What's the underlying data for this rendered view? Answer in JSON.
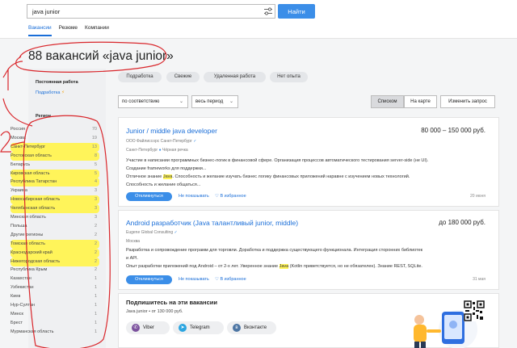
{
  "search": {
    "value": "java junior",
    "button_label": "Найти"
  },
  "tabs": [
    {
      "label": "Вакансии"
    },
    {
      "label": "Резюме"
    },
    {
      "label": "Компании"
    }
  ],
  "page_title": "88 вакансий «java junior»",
  "sidebar": {
    "employment_heading": "Постоянная работа",
    "employment_link": "Подработка",
    "region_heading": "Регион",
    "regions": [
      {
        "name": "Россия",
        "count": "70"
      },
      {
        "name": "Москва",
        "count": "19"
      },
      {
        "name": "Санкт-Петербург",
        "count": "13"
      },
      {
        "name": "Ростовская область",
        "count": "8"
      },
      {
        "name": "Беларусь",
        "count": "5"
      },
      {
        "name": "Кировская область",
        "count": "5"
      },
      {
        "name": "Республика Татарстан",
        "count": "4"
      },
      {
        "name": "Украина",
        "count": "3"
      },
      {
        "name": "Новосибирская область",
        "count": "3"
      },
      {
        "name": "Челябинская область",
        "count": "3"
      },
      {
        "name": "Минская область",
        "count": "3"
      },
      {
        "name": "Польша",
        "count": "2"
      },
      {
        "name": "Другие регионы",
        "count": "2"
      },
      {
        "name": "Томская область",
        "count": "2"
      },
      {
        "name": "Краснодарский край",
        "count": "2"
      },
      {
        "name": "Нижегородская область",
        "count": "2"
      },
      {
        "name": "Республика Крым",
        "count": "2"
      },
      {
        "name": "Казахстан",
        "count": "1"
      },
      {
        "name": "Узбекистан",
        "count": "1"
      },
      {
        "name": "Киев",
        "count": "1"
      },
      {
        "name": "Нур-Султан",
        "count": "1"
      },
      {
        "name": "Минск",
        "count": "1"
      },
      {
        "name": "Брест",
        "count": "1"
      },
      {
        "name": "Мурманская область",
        "count": "1"
      }
    ]
  },
  "chips": [
    {
      "label": "Подработка"
    },
    {
      "label": "Свежие"
    },
    {
      "label": "Удаленная работа"
    },
    {
      "label": "Нет опыта"
    }
  ],
  "sort": {
    "order": "по соответствию",
    "period": "весь период"
  },
  "view": {
    "list": "Списком",
    "map": "На карте",
    "subscribe": "Изменить запрос"
  },
  "vacancies": [
    {
      "title": "Junior / middle java developer",
      "salary": "80 000 – 150 000 руб.",
      "company": "ООО Файлиссорс Санкт-Петербург",
      "city": "Санкт-Петербург",
      "metro": "Чёрная речка",
      "desc": [
        {
          "pre": "Участие в написании программных бизнес-логик в финансовой сфере. Организация процессов автоматического тестирования server-side (не UI).",
          "hl": "",
          "post": ""
        },
        {
          "pre": "Создание frameworks для поддержки...",
          "hl": "",
          "post": ""
        },
        {
          "pre": "Отличное знание ",
          "hl": "Java",
          "post": ". Способность и желание изучать бизнес логику финансовых приложений наравне с изучением новых технологий."
        },
        {
          "pre": "Способность и желание общаться...",
          "hl": "",
          "post": ""
        }
      ],
      "respond": "Откликнуться",
      "hide": "Не показывать",
      "favorite": "В избранное",
      "date": "20 июня"
    },
    {
      "title": "Android разработчик (Java талантливый junior, middle)",
      "salary": "до 180 000 руб.",
      "company": "Eugene Global Consulting",
      "city": "Москва",
      "metro": "",
      "desc": [
        {
          "pre": "Разработка и сопровождение программ для торговли. Доработка и поддержка существующего функционала. Интеграция сторонних библиотек",
          "hl": "",
          "post": ""
        },
        {
          "pre": "и API.",
          "hl": "",
          "post": ""
        },
        {
          "pre": "Опыт разработки приложений под Android – от 2-х лет. Уверенное знание ",
          "hl": "Java",
          "post": " (Kotlin приветствуется, но не обязателен). Знание REST, SQLite."
        }
      ],
      "respond": "Откликнуться",
      "hide": "Не показывать",
      "favorite": "В избранное",
      "date": "31 мая"
    }
  ],
  "subscribe": {
    "title": "Подпишитесь на эти вакансии",
    "meta": "Java junior • от 130 000 руб.",
    "buttons": [
      {
        "label": "Viber",
        "color": "#7b519d",
        "icon": "viber-icon"
      },
      {
        "label": "Telegram",
        "color": "#2ca5e0",
        "icon": "telegram-icon"
      },
      {
        "label": "Вконтакте",
        "color": "#4c75a3",
        "icon": "vk-icon"
      }
    ]
  },
  "annotations": {
    "number_1": "1",
    "number_2": "2"
  },
  "colors": {
    "accent": "#3b8ee8",
    "link": "#1a6ed8",
    "highlight": "#fff45a",
    "annotation": "#d9262b"
  }
}
